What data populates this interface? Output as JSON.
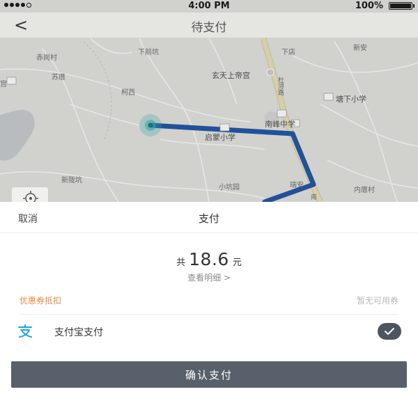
{
  "status_bar": {
    "time": "4:00 PM",
    "battery": "100%"
  },
  "nav": {
    "back_icon": "back-arrow-icon",
    "back_glyph": "<",
    "title": "待支付"
  },
  "map": {
    "labels": {
      "chijiaocun": "赤岗村",
      "xiaqiankeng": "下前坑",
      "xiadian": "下店",
      "xinan": "新安",
      "sucuo": "苏厝",
      "xuantianshangdigong": "玄天上帝宫",
      "gong": "宫",
      "hexi": "柯西",
      "road": "杜浔路",
      "tangxiaxiaoxue": "塘下小学",
      "nanfengzhongxue": "南峰中学",
      "qimengxiaoxue": "启蒙小学",
      "xinlongkeng": "新陇坑",
      "xiaokengyuan": "小坑园",
      "ruian": "瑞安",
      "neicuocun": "内厝村",
      "nan": "南"
    },
    "route_color": "#2458a8",
    "start_marker_color": "#3bb3b8"
  },
  "sheet": {
    "cancel_label": "取消",
    "title": "支付",
    "amount_prefix": "共",
    "amount_value": "18.6",
    "amount_unit": "元",
    "detail_link": "查看明细 >",
    "coupon_label": "优惠券抵扣",
    "coupon_status": "暂无可用券",
    "pay_method_icon": "alipay-icon",
    "pay_method_label": "支付宝支付",
    "pay_method_selected": true,
    "confirm_label": "确认支付"
  },
  "colors": {
    "accent_orange": "#ef8a4b",
    "button_dark": "#58606b",
    "alipay_blue": "#1ea4d8"
  }
}
